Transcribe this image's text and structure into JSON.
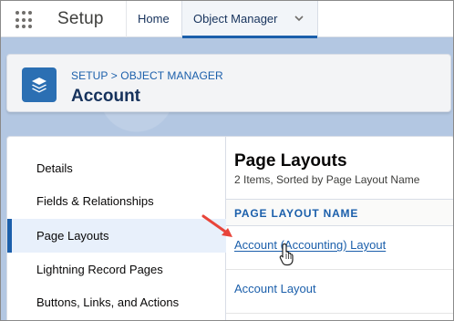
{
  "topnav": {
    "app_name": "Setup",
    "tabs": [
      {
        "label": "Home"
      },
      {
        "label": "Object Manager"
      }
    ]
  },
  "header": {
    "breadcrumb": "SETUP > OBJECT MANAGER",
    "title": "Account",
    "icon": "layers-icon"
  },
  "sidebar": {
    "items": [
      {
        "label": "Details"
      },
      {
        "label": "Fields & Relationships"
      },
      {
        "label": "Page Layouts"
      },
      {
        "label": "Lightning Record Pages"
      },
      {
        "label": "Buttons, Links, and Actions"
      }
    ],
    "active_index": 2
  },
  "content": {
    "title": "Page Layouts",
    "subtitle": "2 Items, Sorted by Page Layout Name",
    "column_header": "PAGE LAYOUT NAME",
    "rows": [
      {
        "name": "Account (Accounting) Layout"
      },
      {
        "name": "Account Layout"
      }
    ]
  },
  "colors": {
    "accent": "#1b5fab",
    "icon_bg": "#2b6fb3",
    "annotation_arrow": "#e8443a"
  }
}
